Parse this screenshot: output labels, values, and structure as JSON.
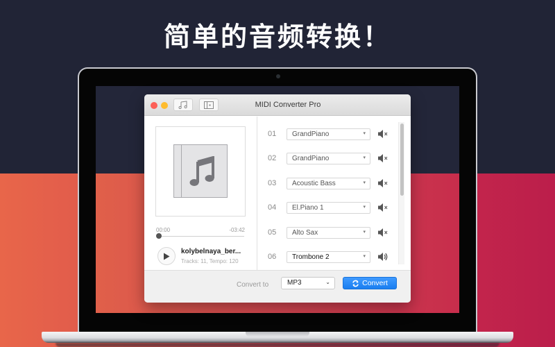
{
  "headline": "简单的音频转换！",
  "colors": {
    "background_top": "#212436",
    "background_bottom_start": "#e8664a",
    "background_bottom_end": "#bb1e4b",
    "accent_button": "#1a7ef0",
    "traffic_close": "#fc5f57",
    "traffic_minimize": "#febc2e"
  },
  "window": {
    "title": "MIDI Converter Pro",
    "toolbar": [
      {
        "icon": "music-notes-icon"
      },
      {
        "icon": "sidebar-toggle-icon"
      }
    ]
  },
  "player": {
    "time_elapsed": "00:00",
    "time_remaining": "-03:42",
    "progress": 0,
    "track_name": "kolybelnaya_ber...",
    "track_meta": "Tracks: 11, Tempo: 120",
    "play_icon": "play-icon"
  },
  "tracks": [
    {
      "number": "01",
      "instrument": "GrandPiano",
      "muted": true
    },
    {
      "number": "02",
      "instrument": "GrandPiano",
      "muted": true
    },
    {
      "number": "03",
      "instrument": "Acoustic Bass",
      "muted": true
    },
    {
      "number": "04",
      "instrument": "El.Piano 1",
      "muted": true
    },
    {
      "number": "05",
      "instrument": "Alto Sax",
      "muted": true
    },
    {
      "number": "06",
      "instrument": "Trombone 2",
      "muted": false
    }
  ],
  "footer": {
    "convert_to_label": "Convert to",
    "format": "MP3",
    "convert_button": "Convert"
  }
}
